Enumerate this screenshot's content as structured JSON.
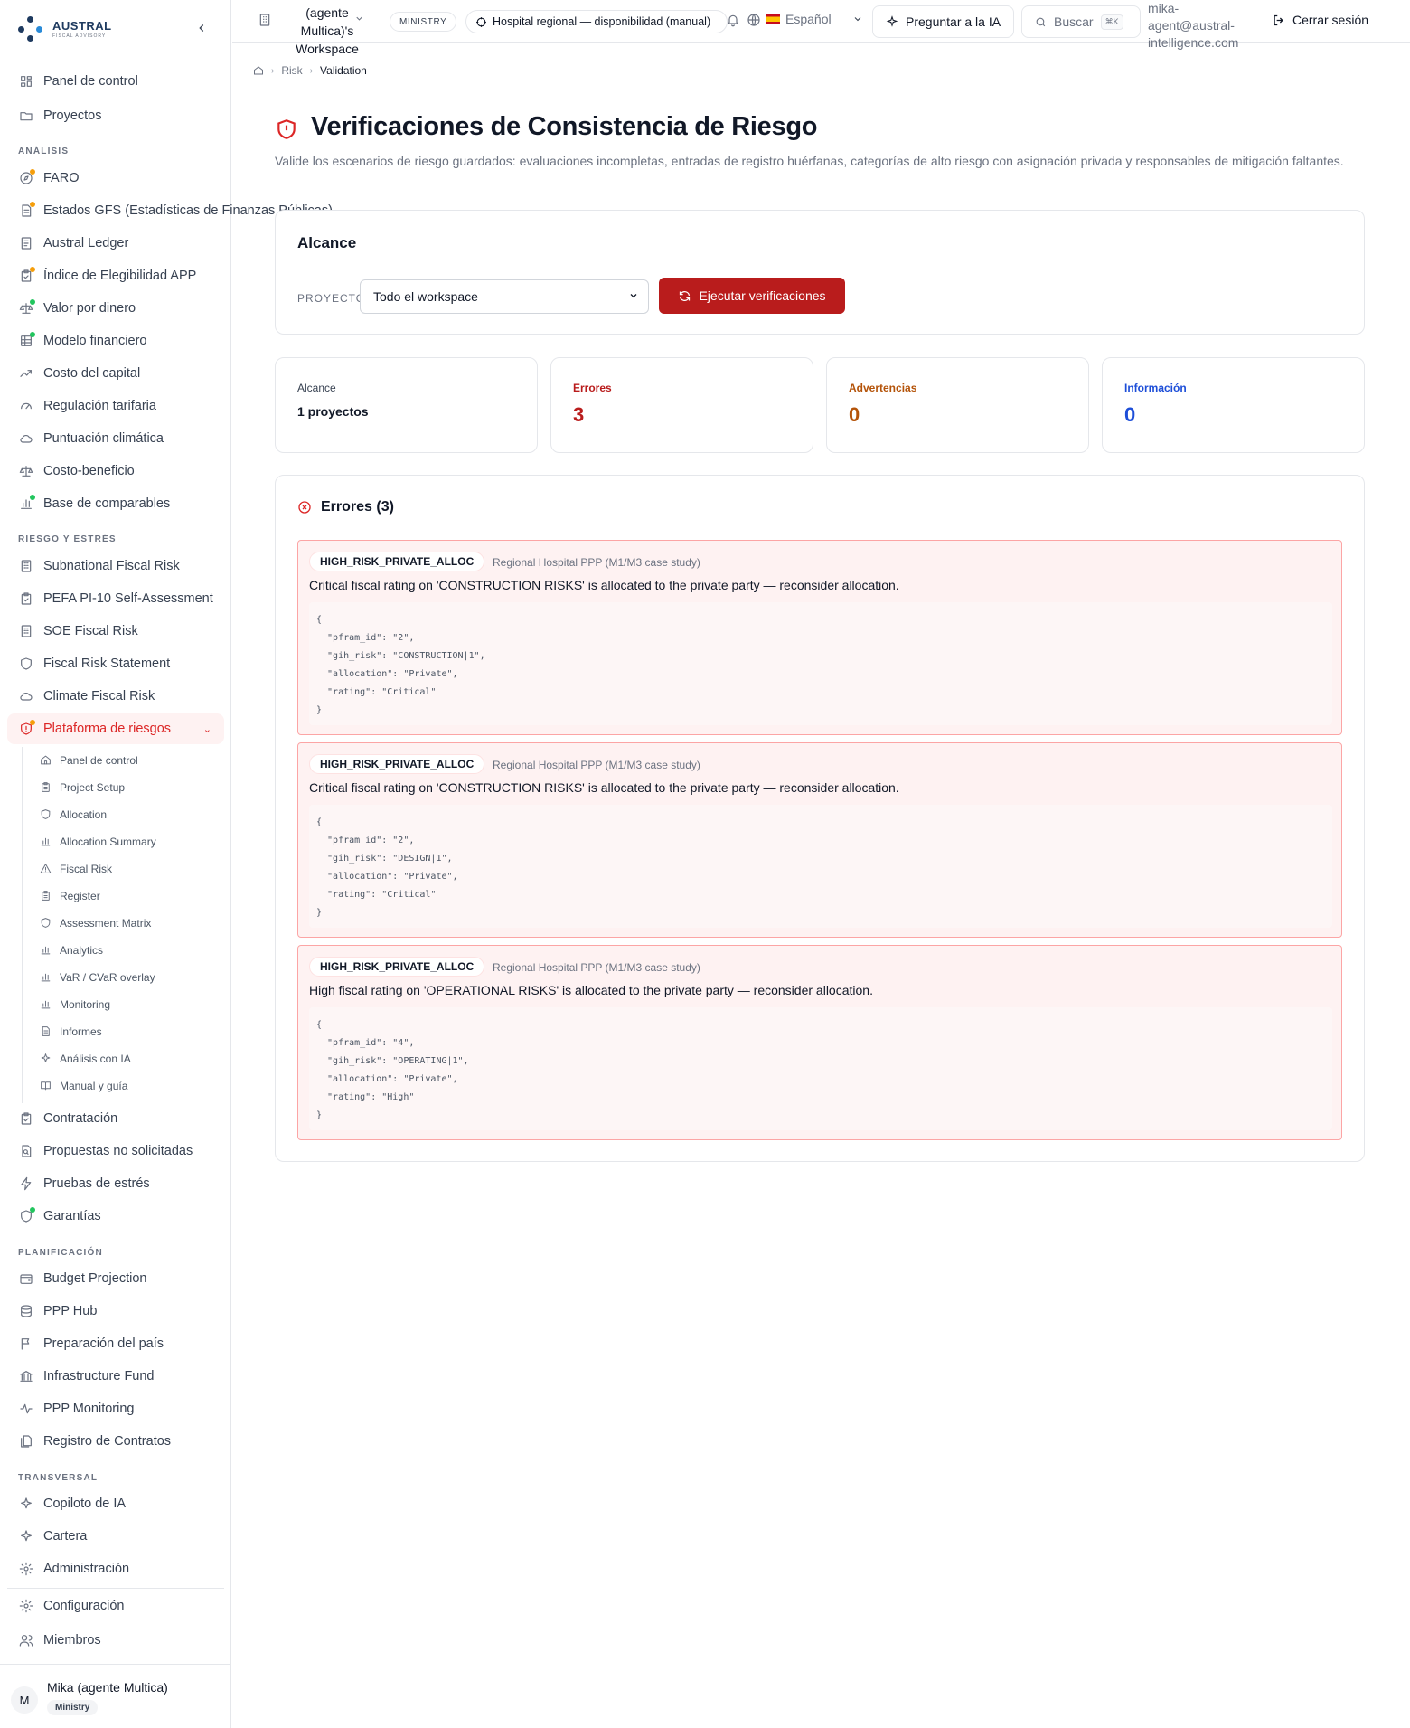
{
  "brand": {
    "name": "AUSTRAL",
    "sub": "FISCAL ADVISORY"
  },
  "sidebar": {
    "top": [
      {
        "label": "Panel de control",
        "icon": "dashboard-icon"
      },
      {
        "label": "Proyectos",
        "icon": "folder-icon"
      }
    ],
    "sections": [
      {
        "label": "ANÁLISIS",
        "items": [
          {
            "label": "FARO",
            "icon": "compass-icon",
            "dot": "orange"
          },
          {
            "label": "Estados GFS (Estadísticas de Finanzas Públicas)",
            "icon": "document-icon",
            "dot": "orange"
          },
          {
            "label": "Austral Ledger",
            "icon": "ledger-icon"
          },
          {
            "label": "Índice de Elegibilidad APP",
            "icon": "clipboard-check-icon",
            "dot": "orange"
          },
          {
            "label": "Valor por dinero",
            "icon": "scale-icon",
            "dot": "green"
          },
          {
            "label": "Modelo financiero",
            "icon": "spreadsheet-icon",
            "dot": "green"
          },
          {
            "label": "Costo del capital",
            "icon": "trending-up-icon"
          },
          {
            "label": "Regulación tarifaria",
            "icon": "gauge-icon"
          },
          {
            "label": "Puntuación climática",
            "icon": "cloud-icon"
          },
          {
            "label": "Costo-beneficio",
            "icon": "scale-icon"
          },
          {
            "label": "Base de comparables",
            "icon": "bar-chart-icon",
            "dot": "green"
          }
        ]
      },
      {
        "label": "RIESGO Y ESTRÉS",
        "items": [
          {
            "label": "Subnational Fiscal Risk",
            "icon": "building-icon"
          },
          {
            "label": "PEFA PI-10 Self-Assessment",
            "icon": "clipboard-check-icon"
          },
          {
            "label": "SOE Fiscal Risk",
            "icon": "building-icon"
          },
          {
            "label": "Fiscal Risk Statement",
            "icon": "shield-icon"
          },
          {
            "label": "Climate Fiscal Risk",
            "icon": "cloud-icon"
          },
          {
            "label": "Plataforma de riesgos",
            "icon": "shield-alert-icon",
            "dot": "orange",
            "active": true
          }
        ]
      }
    ],
    "risk_sub": [
      {
        "label": "Panel de control",
        "icon": "home-icon"
      },
      {
        "label": "Project Setup",
        "icon": "clipboard-icon"
      },
      {
        "label": "Allocation",
        "icon": "shield-icon"
      },
      {
        "label": "Allocation Summary",
        "icon": "bar-chart-icon"
      },
      {
        "label": "Fiscal Risk",
        "icon": "warning-icon"
      },
      {
        "label": "Register",
        "icon": "clipboard-icon"
      },
      {
        "label": "Assessment Matrix",
        "icon": "shield-icon"
      },
      {
        "label": "Analytics",
        "icon": "bar-chart-icon"
      },
      {
        "label": "VaR / CVaR overlay",
        "icon": "bar-chart-icon"
      },
      {
        "label": "Monitoring",
        "icon": "bar-chart-icon"
      },
      {
        "label": "Informes",
        "icon": "document-icon"
      },
      {
        "label": "Análisis con IA",
        "icon": "sparkles-icon"
      },
      {
        "label": "Manual y guía",
        "icon": "book-icon"
      }
    ],
    "after_risk": [
      {
        "label": "Contratación",
        "icon": "clipboard-check-icon"
      },
      {
        "label": "Propuestas no solicitadas",
        "icon": "search-document-icon"
      },
      {
        "label": "Pruebas de estrés",
        "icon": "lightning-icon"
      },
      {
        "label": "Garantías",
        "icon": "shield-icon",
        "dot": "green"
      }
    ],
    "planning": {
      "label": "PLANIFICACIÓN",
      "items": [
        {
          "label": "Budget Projection",
          "icon": "wallet-icon"
        },
        {
          "label": "PPP Hub",
          "icon": "database-icon"
        },
        {
          "label": "Preparación del país",
          "icon": "flag-icon"
        },
        {
          "label": "Infrastructure Fund",
          "icon": "bank-icon"
        },
        {
          "label": "PPP Monitoring",
          "icon": "activity-icon"
        },
        {
          "label": "Registro de Contratos",
          "icon": "file-stack-icon"
        }
      ]
    },
    "transversal": {
      "label": "TRANSVERSAL",
      "items": [
        {
          "label": "Copiloto de IA",
          "icon": "sparkles-icon"
        },
        {
          "label": "Cartera",
          "icon": "sparkles-icon"
        },
        {
          "label": "Administración",
          "icon": "gear-icon"
        }
      ]
    },
    "bottom": [
      {
        "label": "Configuración",
        "icon": "gear-icon"
      },
      {
        "label": "Miembros",
        "icon": "users-icon"
      }
    ],
    "user": {
      "initial": "M",
      "name": "Mika (agente Multica)",
      "role": "Ministry"
    }
  },
  "header": {
    "workspace": "(agente Multica)'s Workspace",
    "badge": "MINISTRY",
    "project": "Hospital regional — disponibilidad (manual)",
    "language": "Español",
    "ask_ai": "Preguntar a la IA",
    "search": "Buscar",
    "search_kbd": "⌘K",
    "email": "mika-agent@austral-intelligence.com",
    "logout": "Cerrar sesión"
  },
  "breadcrumb": {
    "section": "Risk",
    "current": "Validation"
  },
  "page": {
    "title": "Verificaciones de Consistencia de Riesgo",
    "description": "Valide los escenarios de riesgo guardados: evaluaciones incompletas, entradas de registro huérfanas, categorías de alto riesgo con asignación privada y responsables de mitigación faltantes."
  },
  "scope": {
    "title": "Alcance",
    "project_label": "PROYECTO",
    "project_value": "Todo el workspace",
    "run_button": "Ejecutar verificaciones"
  },
  "stats": [
    {
      "label": "Alcance",
      "value": "1 proyectos",
      "color": "#374151"
    },
    {
      "label": "Errores",
      "value": "3",
      "color": "#b91c1c"
    },
    {
      "label": "Advertencias",
      "value": "0",
      "color": "#b45309"
    },
    {
      "label": "Información",
      "value": "0",
      "color": "#1d4ed8"
    }
  ],
  "errors": {
    "title": "Errores (3)",
    "items": [
      {
        "code": "HIGH_RISK_PRIVATE_ALLOC",
        "project": "Regional Hospital PPP (M1/M3 case study)",
        "message": "Critical fiscal rating on 'CONSTRUCTION RISKS' is allocated to the private party — reconsider allocation.",
        "json": "{\n  \"pfram_id\": \"2\",\n  \"gih_risk\": \"CONSTRUCTION|1\",\n  \"allocation\": \"Private\",\n  \"rating\": \"Critical\"\n}"
      },
      {
        "code": "HIGH_RISK_PRIVATE_ALLOC",
        "project": "Regional Hospital PPP (M1/M3 case study)",
        "message": "Critical fiscal rating on 'CONSTRUCTION RISKS' is allocated to the private party — reconsider allocation.",
        "json": "{\n  \"pfram_id\": \"2\",\n  \"gih_risk\": \"DESIGN|1\",\n  \"allocation\": \"Private\",\n  \"rating\": \"Critical\"\n}"
      },
      {
        "code": "HIGH_RISK_PRIVATE_ALLOC",
        "project": "Regional Hospital PPP (M1/M3 case study)",
        "message": "High fiscal rating on 'OPERATIONAL RISKS' is allocated to the private party — reconsider allocation.",
        "json": "{\n  \"pfram_id\": \"4\",\n  \"gih_risk\": \"OPERATING|1\",\n  \"allocation\": \"Private\",\n  \"rating\": \"High\"\n}"
      }
    ]
  }
}
